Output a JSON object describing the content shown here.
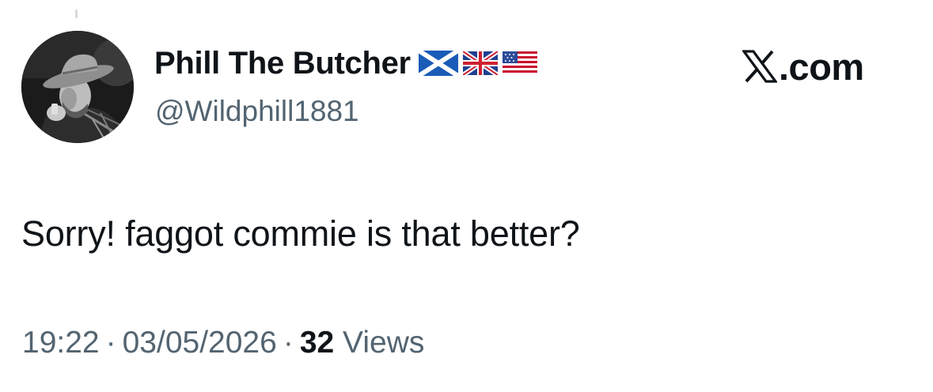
{
  "tweet": {
    "author": {
      "display_name": "Phill The Butcher",
      "handle": "@Wildphill1881",
      "name_flags": [
        "scotland-flag",
        "uk-flag",
        "us-flag"
      ]
    },
    "brand": {
      "logo": "x-logo-icon",
      "domain": ".com"
    },
    "text": "Sorry! faggot commie is that better?",
    "meta": {
      "time": "19:22",
      "separator": "·",
      "date": "03/05/2026",
      "views_count": "32",
      "views_label": "Views"
    }
  },
  "colors": {
    "primary_text": "#0f1419",
    "secondary_text": "#536471",
    "background": "#ffffff"
  }
}
